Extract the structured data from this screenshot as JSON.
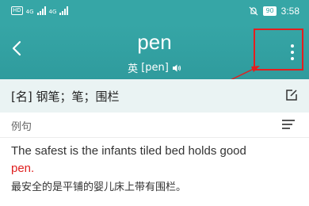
{
  "status_bar": {
    "left_badge": "HD",
    "network_1": "4G",
    "network_2": "4G",
    "battery": "90",
    "time": "3:58"
  },
  "header": {
    "word": "pen",
    "accent_label": "英",
    "phonetic": "[pen]",
    "back_icon": "chevron-left-icon",
    "menu_icon": "more-vertical-icon",
    "speaker_icon": "speaker-icon"
  },
  "definition": {
    "text": "[名] 钢笔；笔；围栏",
    "edit_icon": "edit-icon"
  },
  "examples_section": {
    "label": "例句",
    "sort_icon": "list-icon"
  },
  "example": {
    "en_prefix": "The safest is the infants tiled bed holds good",
    "en_highlight": "pen",
    "en_suffix": ".",
    "cn": "最安全的是平铺的婴儿床上带有围栏。"
  },
  "colors": {
    "header_bg": "#36a6a6",
    "highlight": "#e41e1e",
    "keyword": "#e02020"
  }
}
